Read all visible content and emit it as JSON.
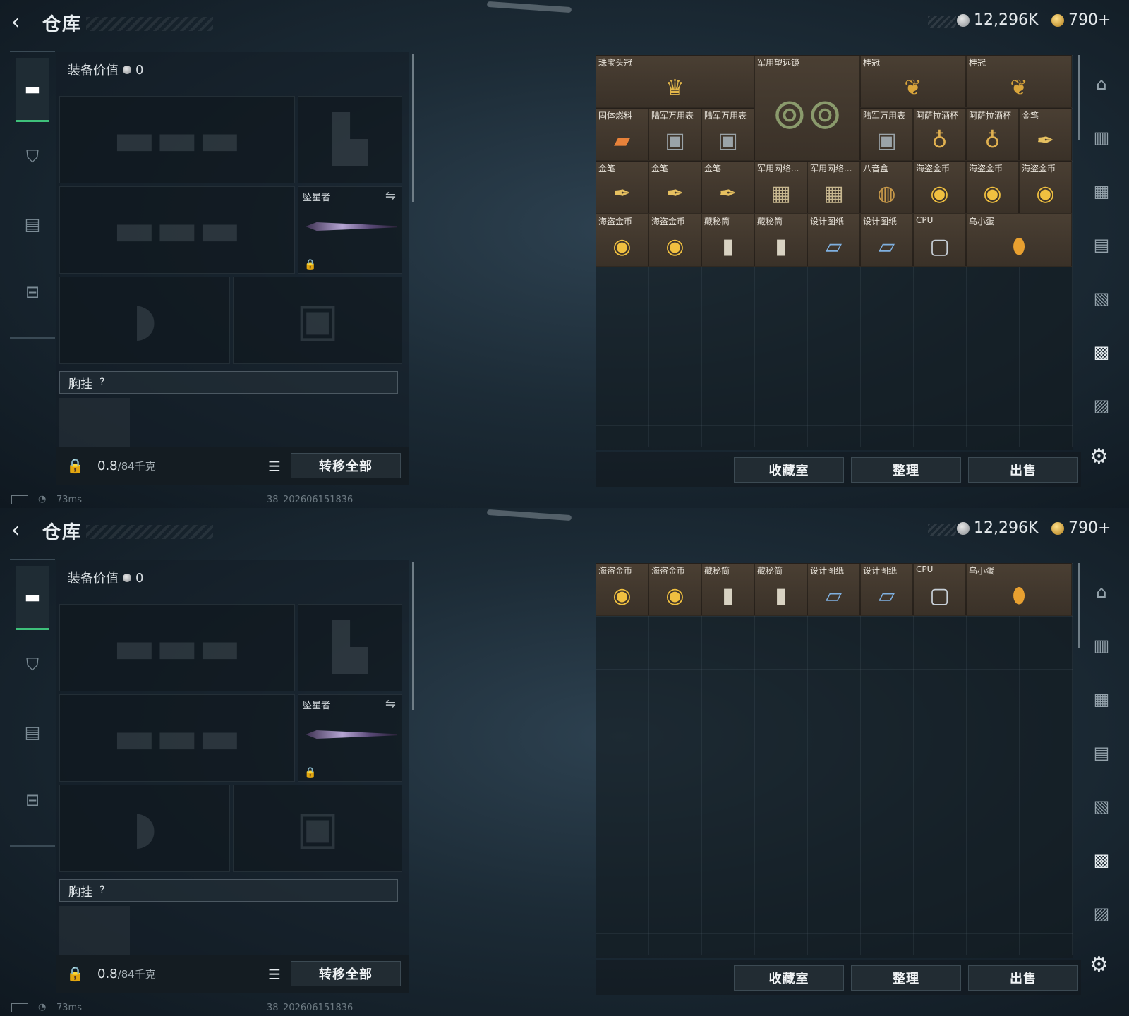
{
  "screens": [
    {
      "header": {
        "back_icon": "‹",
        "title": "仓库",
        "silver_amount": "12,296K",
        "gold_amount": "790+"
      },
      "equipment": {
        "value_label": "装备价值",
        "value": "0",
        "melee_slot_name": "坠星者",
        "chest_label": "胸挂",
        "chest_help": "?",
        "weight_current": "0.8",
        "weight_max": "/84千克",
        "transfer_all": "转移全部"
      },
      "storage": {
        "buttons": {
          "collection": "收藏室",
          "organize": "整理",
          "sell": "出售"
        },
        "items": [
          {
            "label": "珠宝头冠",
            "icon": "crown",
            "row": 0,
            "col": 0,
            "w": 3,
            "h": 1
          },
          {
            "label": "军用望远镜",
            "icon": "binoculars",
            "row": 0,
            "col": 3,
            "w": 2,
            "h": 2
          },
          {
            "label": "桂冠",
            "icon": "laurel",
            "row": 0,
            "col": 5,
            "w": 2,
            "h": 1
          },
          {
            "label": "桂冠",
            "icon": "laurel",
            "row": 0,
            "col": 7,
            "w": 2,
            "h": 1
          },
          {
            "label": "固体燃料",
            "icon": "fuel",
            "row": 1,
            "col": 0,
            "w": 1,
            "h": 1
          },
          {
            "label": "陆军万用表",
            "icon": "multimeter",
            "row": 1,
            "col": 1,
            "w": 1,
            "h": 1
          },
          {
            "label": "陆军万用表",
            "icon": "multimeter",
            "row": 1,
            "col": 2,
            "w": 1,
            "h": 1
          },
          {
            "label": "陆军万用表",
            "icon": "multimeter",
            "row": 1,
            "col": 5,
            "w": 1,
            "h": 1
          },
          {
            "label": "阿萨拉酒杯",
            "icon": "goblet",
            "row": 1,
            "col": 6,
            "w": 1,
            "h": 1
          },
          {
            "label": "阿萨拉酒杯",
            "icon": "goblet",
            "row": 1,
            "col": 7,
            "w": 1,
            "h": 1
          },
          {
            "label": "金笔",
            "icon": "pen",
            "row": 1,
            "col": 8,
            "w": 1,
            "h": 1
          },
          {
            "label": "金笔",
            "icon": "pen",
            "row": 2,
            "col": 0,
            "w": 1,
            "h": 1
          },
          {
            "label": "金笔",
            "icon": "pen",
            "row": 2,
            "col": 1,
            "w": 1,
            "h": 1
          },
          {
            "label": "金笔",
            "icon": "pen",
            "row": 2,
            "col": 2,
            "w": 1,
            "h": 1
          },
          {
            "label": "军用网络...",
            "icon": "network",
            "row": 2,
            "col": 3,
            "w": 1,
            "h": 1
          },
          {
            "label": "军用网络...",
            "icon": "network",
            "row": 2,
            "col": 4,
            "w": 1,
            "h": 1
          },
          {
            "label": "八音盒",
            "icon": "musicbox",
            "row": 2,
            "col": 5,
            "w": 1,
            "h": 1
          },
          {
            "label": "海盗金币",
            "icon": "coin",
            "row": 2,
            "col": 6,
            "w": 1,
            "h": 1
          },
          {
            "label": "海盗金币",
            "icon": "coin",
            "row": 2,
            "col": 7,
            "w": 1,
            "h": 1
          },
          {
            "label": "海盗金币",
            "icon": "coin",
            "row": 2,
            "col": 8,
            "w": 1,
            "h": 1
          },
          {
            "label": "海盗金币",
            "icon": "coin",
            "row": 3,
            "col": 0,
            "w": 1,
            "h": 1
          },
          {
            "label": "海盗金币",
            "icon": "coin",
            "row": 3,
            "col": 1,
            "w": 1,
            "h": 1
          },
          {
            "label": "藏秘筒",
            "icon": "cylinder",
            "row": 3,
            "col": 2,
            "w": 1,
            "h": 1
          },
          {
            "label": "藏秘筒",
            "icon": "cylinder",
            "row": 3,
            "col": 3,
            "w": 1,
            "h": 1
          },
          {
            "label": "设计图纸",
            "icon": "blueprint",
            "row": 3,
            "col": 4,
            "w": 1,
            "h": 1
          },
          {
            "label": "设计图纸",
            "icon": "blueprint",
            "row": 3,
            "col": 5,
            "w": 1,
            "h": 1
          },
          {
            "label": "CPU",
            "icon": "cpu",
            "row": 3,
            "col": 6,
            "w": 1,
            "h": 1
          },
          {
            "label": "乌小蛋",
            "icon": "egg",
            "row": 3,
            "col": 7,
            "w": 2,
            "h": 1
          }
        ]
      },
      "status": {
        "ping": "73ms",
        "build": "38_202606151836"
      }
    },
    {
      "header": {
        "back_icon": "‹",
        "title": "仓库",
        "silver_amount": "12,296K",
        "gold_amount": "790+"
      },
      "equipment": {
        "value_label": "装备价值",
        "value": "0",
        "melee_slot_name": "坠星者",
        "chest_label": "胸挂",
        "chest_help": "?",
        "weight_current": "0.8",
        "weight_max": "/84千克",
        "transfer_all": "转移全部"
      },
      "storage": {
        "buttons": {
          "collection": "收藏室",
          "organize": "整理",
          "sell": "出售"
        },
        "items": [
          {
            "label": "海盗金币",
            "icon": "coin",
            "row": 0,
            "col": 0,
            "w": 1,
            "h": 1
          },
          {
            "label": "海盗金币",
            "icon": "coin",
            "row": 0,
            "col": 1,
            "w": 1,
            "h": 1
          },
          {
            "label": "藏秘筒",
            "icon": "cylinder",
            "row": 0,
            "col": 2,
            "w": 1,
            "h": 1
          },
          {
            "label": "藏秘筒",
            "icon": "cylinder",
            "row": 0,
            "col": 3,
            "w": 1,
            "h": 1
          },
          {
            "label": "设计图纸",
            "icon": "blueprint",
            "row": 0,
            "col": 4,
            "w": 1,
            "h": 1
          },
          {
            "label": "设计图纸",
            "icon": "blueprint",
            "row": 0,
            "col": 5,
            "w": 1,
            "h": 1
          },
          {
            "label": "CPU",
            "icon": "cpu",
            "row": 0,
            "col": 6,
            "w": 1,
            "h": 1
          },
          {
            "label": "乌小蛋",
            "icon": "egg",
            "row": 0,
            "col": 7,
            "w": 2,
            "h": 1
          }
        ]
      },
      "status": {
        "ping": "73ms",
        "build": "38_202606151836"
      }
    }
  ],
  "colors": {
    "active_tab": "#3ec07a",
    "item_bg": "#4a3f33"
  }
}
